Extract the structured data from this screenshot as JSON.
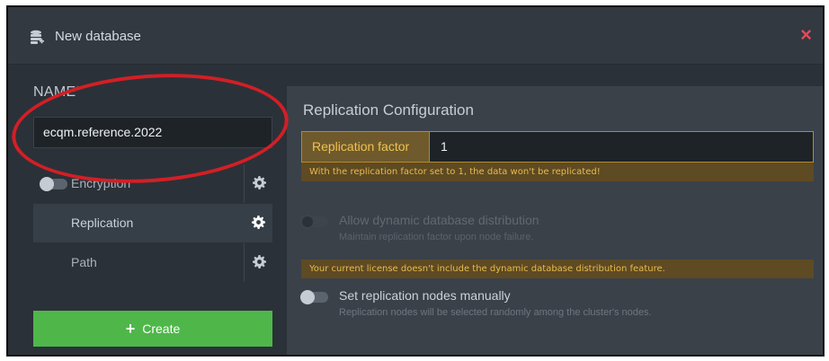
{
  "header": {
    "title": "New database",
    "icon": "database-add-icon",
    "close_icon": "close-icon",
    "close_label": "×"
  },
  "name_field": {
    "label": "NAME",
    "required_mark": "*",
    "value": "ecqm.reference.2022"
  },
  "options": [
    {
      "label": "Encryption",
      "enabled": false,
      "icon": "gear-icon"
    },
    {
      "label": "Replication",
      "active": true,
      "icon": "gear-icon"
    },
    {
      "label": "Path",
      "icon": "gear-icon"
    }
  ],
  "create_button": {
    "label": "Create",
    "icon": "plus-icon",
    "plus_glyph": "+"
  },
  "replication": {
    "title": "Replication Configuration",
    "factor_label": "Replication factor",
    "factor_value": "1",
    "factor_warning": "With the replication factor set to 1, the data won't be replicated!",
    "dynamic_distribution": {
      "label": "Allow dynamic database distribution",
      "description": "Maintain replication factor upon node failure.",
      "enabled": false,
      "disabled": true
    },
    "license_warning": "Your current license doesn't include the dynamic database distribution feature.",
    "manual_nodes": {
      "label": "Set replication nodes manually",
      "description": "Replication nodes will be selected randomly among the cluster's nodes.",
      "enabled": false
    }
  },
  "colors": {
    "accent_green": "#4fb74a",
    "warning_text": "#e8bb4d",
    "close_red": "#e8485a",
    "annotation_red": "#d21f26"
  }
}
